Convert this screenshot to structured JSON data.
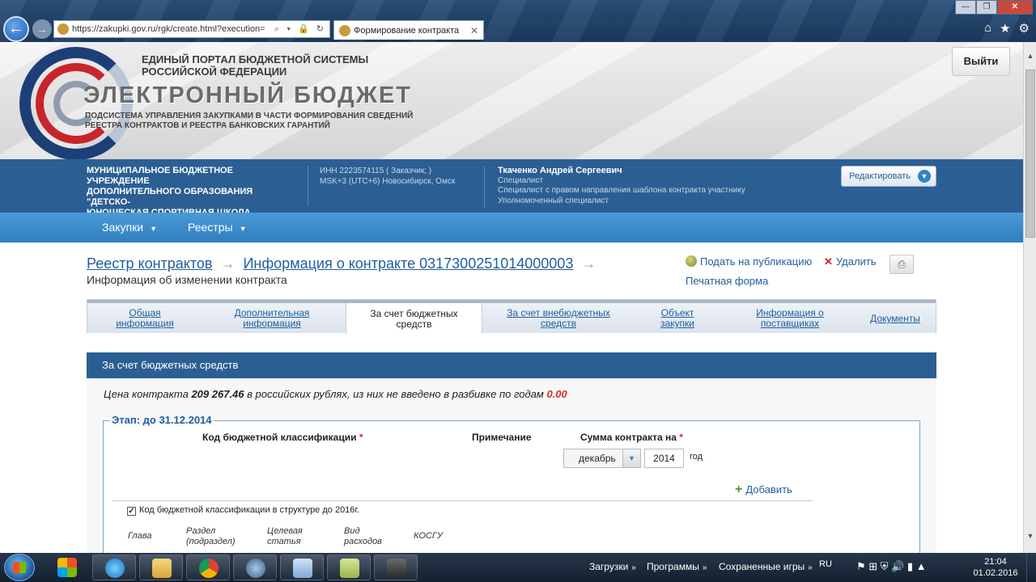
{
  "browser": {
    "url": "https://zakupki.gov.ru/rgk/create.html?execution=",
    "tab_title": "Формирование контракта",
    "tab_close": "✕",
    "back_icon": "arrow-left-icon",
    "forward_icon": "arrow-right-icon",
    "controls": {
      "minimize": "—",
      "maximize": "❐",
      "close": "✕"
    },
    "icons": {
      "home": "⌂",
      "favorites": "★",
      "settings": "⚙"
    },
    "addr_icons": "⌕ ▾ 🔒 ↻"
  },
  "header": {
    "portal_line1": "ЕДИНЫЙ ПОРТАЛ БЮДЖЕТНОЙ СИСТЕМЫ",
    "portal_line2": "РОССИЙСКОЙ ФЕДЕРАЦИИ",
    "product_name": "ЭЛЕКТРОННЫЙ БЮДЖЕТ",
    "subsystem_line1": "ПОДСИСТЕМА УПРАВЛЕНИЯ ЗАКУПКАМИ В ЧАСТИ ФОРМИРОВАНИЯ СВЕДЕНИЙ",
    "subsystem_line2": "РЕЕСТРА КОНТРАКТОВ И РЕЕСТРА БАНКОВСКИХ ГАРАНТИЙ",
    "logout_label": "Выйти"
  },
  "info_bar": {
    "org_line1": "МУНИЦИПАЛЬНОЕ БЮДЖЕТНОЕ УЧРЕЖДЕНИЕ",
    "org_line2": "ДОПОЛНИТЕЛЬНОГО ОБРАЗОВАНИЯ \"ДЕТСКО-",
    "org_line3": "ЮНОШЕСКАЯ СПОРТИВНАЯ ШКОЛА \"ПОБЕДА\"",
    "inn": "ИНН 2223574115 ( Заказчик; )",
    "timezone": "MSK+3 (UTC+6) Новосибирск, Омск",
    "user_name": "Ткаченко Андрей Сергеевич",
    "role1": "Специалист",
    "role2": "Специалист с правом направления шаблона контракта участнику",
    "role3": "Уполномоченный специалист",
    "edit_label": "Редактировать",
    "edit_chevron": "▼"
  },
  "menu": {
    "items": [
      {
        "label": "Закупки",
        "caret": "▼"
      },
      {
        "label": "Реестры",
        "caret": "▼"
      }
    ]
  },
  "breadcrumb": {
    "item1": "Реестр контрактов",
    "sep": "→",
    "item2": "Информация о контракте 0317300251014000003",
    "subtitle": "Информация об изменении контракта"
  },
  "actions": {
    "publish": "Подать на публикацию",
    "delete_icon": "✕",
    "delete": "Удалить",
    "print_icon": "⎙",
    "print_form": "Печатная форма"
  },
  "tabs": [
    {
      "line1": "Общая",
      "line2": "информация"
    },
    {
      "line1": "Дополнительная",
      "line2": "информация"
    },
    {
      "line1": "За счет бюджетных",
      "line2": "средств"
    },
    {
      "line1": "За счет внебюджетных",
      "line2": "средств"
    },
    {
      "line1": "Объект",
      "line2": "закупки"
    },
    {
      "line1": "Информация о",
      "line2": "поставщиках"
    },
    {
      "line1": "Документы",
      "line2": ""
    }
  ],
  "section": {
    "title": "За счет бюджетных средств",
    "price_prefix": "Цена контракта",
    "price_value": "209 267.46",
    "price_middle": "в российских рублях, из них не введено в разбивке по годам",
    "price_unallocated": "0.00",
    "stage_label": "Этап: до 31.12.2014",
    "col_kbk": "Код бюджетной классификации",
    "col_note": "Примечание",
    "col_sum": "Сумма контракта на",
    "required_mark": "*",
    "month_value": "декабрь",
    "month_arrow": "▼",
    "year_value": "2014",
    "year_suffix": "год",
    "add_label": "Добавить",
    "add_icon": "+",
    "checkbox_mark": "✓",
    "kbk_checkbox_label": "Код бюджетной классификации в структуре до 2016г.",
    "kbk_cols": {
      "glava": "Глава",
      "razdel1": "Раздел",
      "razdel2": "(подраздел)",
      "statya1": "Целевая",
      "statya2": "статья",
      "vid1": "Вид",
      "vid2": "расходов",
      "kosgu": "КОСГУ"
    }
  },
  "scrollbar": {
    "up": "▲",
    "down": "▼"
  },
  "taskbar": {
    "downloads": "Загрузки",
    "programs": "Программы",
    "saved_games": "Сохраненные игры",
    "chev": "»",
    "lang": "RU",
    "time": "21:04",
    "date": "01.02.2016",
    "tray_icons": "⚑ ⊞ ⛨ 🔊 ▮ ▲"
  },
  "colors": {
    "header_blue": "#2b5f93",
    "menu_blue": "#3a8ccc",
    "link_blue": "#1f5e9e",
    "required_red": "#d32f2f"
  }
}
